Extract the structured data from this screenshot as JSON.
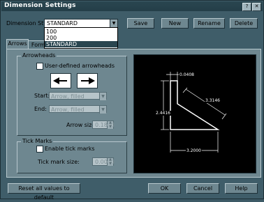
{
  "window": {
    "title": "Dimension Settings"
  },
  "style": {
    "label": "Dimension Style:",
    "value": "STANDARD",
    "options": [
      "100",
      "200",
      "STANDARD"
    ]
  },
  "toolbar": {
    "save": "Save",
    "new": "New",
    "rename": "Rename",
    "delete": "Delete"
  },
  "tabs": [
    "Arrows",
    "Form",
    "",
    ""
  ],
  "arrowheads": {
    "group": "Arrowheads",
    "user_defined": "User-defined arrowheads",
    "start_label": "Start:",
    "start_value": "Arrow, filled",
    "end_label": "End:",
    "end_value": "Arrow, filled",
    "size_label": "Arrow size:",
    "size_value": "0.1800"
  },
  "ticks": {
    "group": "Tick Marks",
    "enable": "Enable tick marks",
    "size_label": "Tick mark size:",
    "size_value": "0.0000"
  },
  "preview": {
    "d1": "0.0408",
    "d2": "2.4416",
    "d3": "3.3146",
    "d4": "3.2000"
  },
  "footer": {
    "reset": "Reset all values to default",
    "ok": "OK",
    "cancel": "Cancel",
    "help": "Help"
  }
}
